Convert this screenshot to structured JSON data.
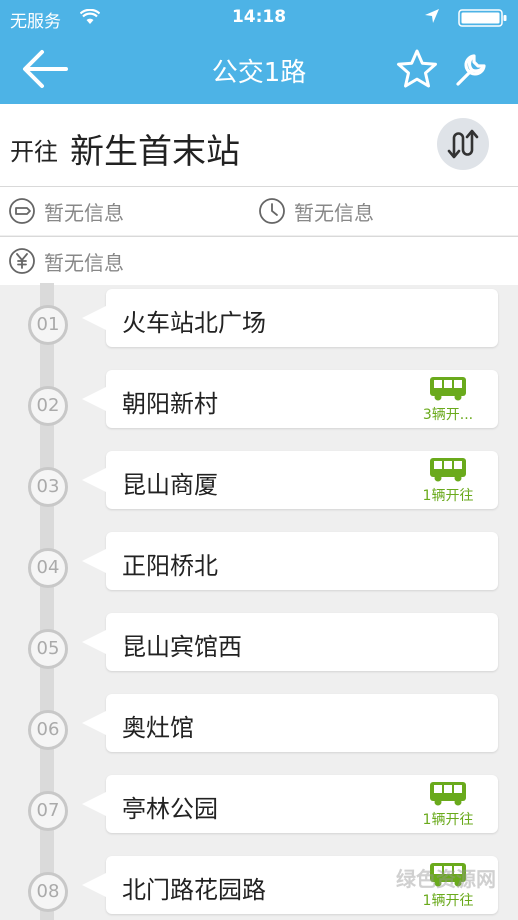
{
  "status_bar": {
    "carrier": "无服务",
    "time": "14:18"
  },
  "header": {
    "title": "公交1路"
  },
  "direction": {
    "prefix": "开往",
    "destination": "新生首末站"
  },
  "info": {
    "interval": "暂无信息",
    "time": "暂无信息",
    "price": "暂无信息"
  },
  "stops": [
    {
      "num": "01",
      "name": "火车站北广场",
      "bus": ""
    },
    {
      "num": "02",
      "name": "朝阳新村",
      "bus": "3辆开..."
    },
    {
      "num": "03",
      "name": "昆山商厦",
      "bus": "1辆开往"
    },
    {
      "num": "04",
      "name": "正阳桥北",
      "bus": ""
    },
    {
      "num": "05",
      "name": "昆山宾馆西",
      "bus": ""
    },
    {
      "num": "06",
      "name": "奥灶馆",
      "bus": ""
    },
    {
      "num": "07",
      "name": "亭林公园",
      "bus": "1辆开往"
    },
    {
      "num": "08",
      "name": "北门路花园路",
      "bus": "1辆开往"
    }
  ],
  "watermark": "绿色资源网",
  "colors": {
    "header": "#4db3e6",
    "bus": "#6aaa1c",
    "track": "#dadada"
  }
}
